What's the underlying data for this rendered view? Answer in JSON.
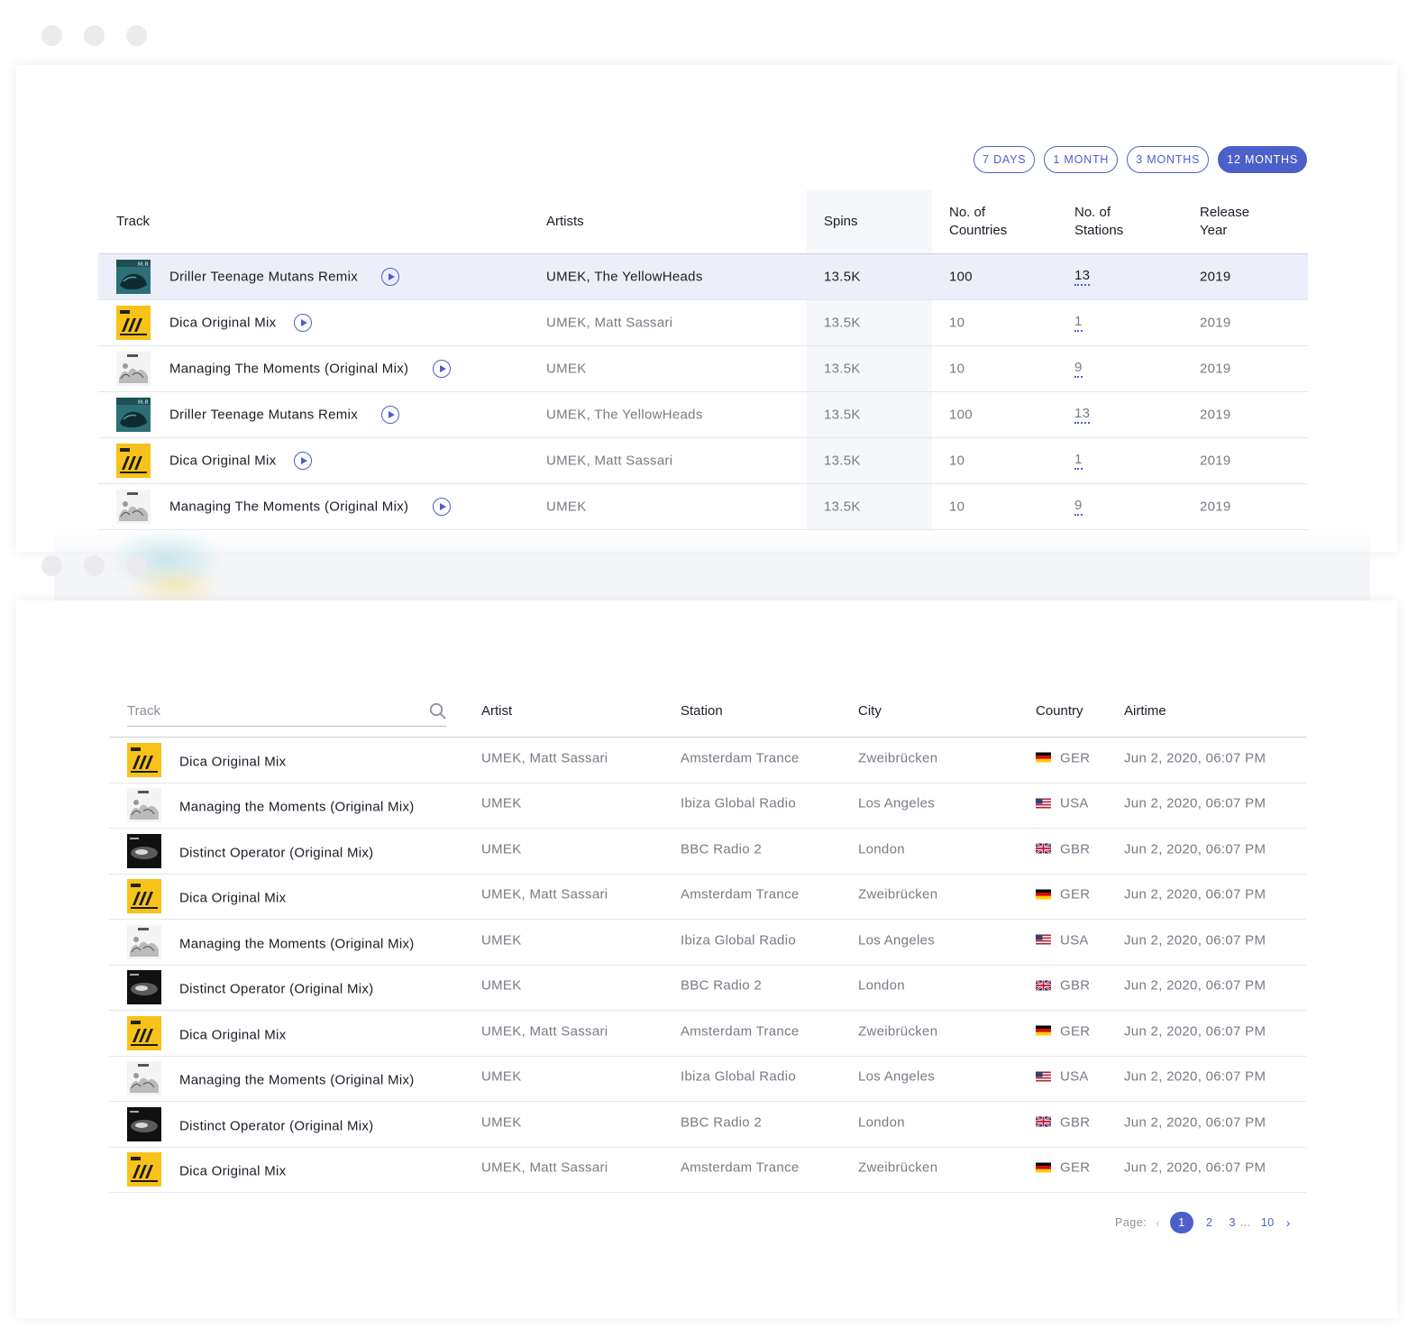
{
  "periods": [
    {
      "label": "7 DAYS",
      "active": false
    },
    {
      "label": "1 MONTH",
      "active": false
    },
    {
      "label": "3 MONTHS",
      "active": false
    },
    {
      "label": "12 MONTHS",
      "active": true
    }
  ],
  "tracks_table": {
    "headers": {
      "track": "Track",
      "artists": "Artists",
      "spins": "Spins",
      "countries_1": "No. of",
      "countries_2": "Countries",
      "stations_1": "No. of",
      "stations_2": "Stations",
      "release_1": "Release",
      "release_2": "Year"
    },
    "rows": [
      {
        "cover": "teal",
        "track": "Driller Teenage Mutans Remix",
        "artists": "UMEK, The YellowHeads",
        "spins": "13.5K",
        "countries": "100",
        "stations": "13",
        "year": "2019"
      },
      {
        "cover": "yellow",
        "track": "Dica Original Mix",
        "artists": "UMEK, Matt Sassari",
        "spins": "13.5K",
        "countries": "10",
        "stations": "1",
        "year": "2019"
      },
      {
        "cover": "sketch",
        "track": "Managing The Moments (Original Mix)",
        "artists": "UMEK",
        "spins": "13.5K",
        "countries": "10",
        "stations": "9",
        "year": "2019"
      },
      {
        "cover": "teal",
        "track": "Driller Teenage Mutans Remix",
        "artists": "UMEK, The YellowHeads",
        "spins": "13.5K",
        "countries": "100",
        "stations": "13",
        "year": "2019"
      },
      {
        "cover": "yellow",
        "track": "Dica Original Mix",
        "artists": "UMEK, Matt Sassari",
        "spins": "13.5K",
        "countries": "10",
        "stations": "1",
        "year": "2019"
      },
      {
        "cover": "sketch",
        "track": "Managing The Moments (Original Mix)",
        "artists": "UMEK",
        "spins": "13.5K",
        "countries": "10",
        "stations": "9",
        "year": "2019"
      }
    ]
  },
  "airplay_table": {
    "search_placeholder": "Track",
    "headers": {
      "artist": "Artist",
      "station": "Station",
      "city": "City",
      "country": "Country",
      "airtime": "Airtime"
    },
    "rows": [
      {
        "cover": "yellow",
        "track": "Dica Original Mix",
        "artist": "UMEK, Matt Sassari",
        "station": "Amsterdam Trance",
        "city": "Zweibrücken",
        "flag": "de",
        "country": "GER",
        "airtime": "Jun 2, 2020, 06:07 PM"
      },
      {
        "cover": "sketch",
        "track": "Managing the Moments (Original Mix)",
        "artist": "UMEK",
        "station": "Ibiza Global Radio",
        "city": "Los Angeles",
        "flag": "us",
        "country": "USA",
        "airtime": "Jun 2, 2020, 06:07 PM"
      },
      {
        "cover": "dark",
        "track": "Distinct Operator (Original Mix)",
        "artist": "UMEK",
        "station": "BBC Radio 2",
        "city": "London",
        "flag": "gb",
        "country": "GBR",
        "airtime": "Jun 2, 2020, 06:07 PM"
      },
      {
        "cover": "yellow",
        "track": "Dica Original Mix",
        "artist": "UMEK, Matt Sassari",
        "station": "Amsterdam Trance",
        "city": "Zweibrücken",
        "flag": "de",
        "country": "GER",
        "airtime": "Jun 2, 2020, 06:07 PM"
      },
      {
        "cover": "sketch",
        "track": "Managing the Moments (Original Mix)",
        "artist": "UMEK",
        "station": "Ibiza Global Radio",
        "city": "Los Angeles",
        "flag": "us",
        "country": "USA",
        "airtime": "Jun 2, 2020, 06:07 PM"
      },
      {
        "cover": "dark",
        "track": "Distinct Operator (Original Mix)",
        "artist": "UMEK",
        "station": "BBC Radio 2",
        "city": "London",
        "flag": "gb",
        "country": "GBR",
        "airtime": "Jun 2, 2020, 06:07 PM"
      },
      {
        "cover": "yellow",
        "track": "Dica Original Mix",
        "artist": "UMEK, Matt Sassari",
        "station": "Amsterdam Trance",
        "city": "Zweibrücken",
        "flag": "de",
        "country": "GER",
        "airtime": "Jun 2, 2020, 06:07 PM"
      },
      {
        "cover": "sketch",
        "track": "Managing the Moments (Original Mix)",
        "artist": "UMEK",
        "station": "Ibiza Global Radio",
        "city": "Los Angeles",
        "flag": "us",
        "country": "USA",
        "airtime": "Jun 2, 2020, 06:07 PM"
      },
      {
        "cover": "dark",
        "track": "Distinct Operator (Original Mix)",
        "artist": "UMEK",
        "station": "BBC Radio 2",
        "city": "London",
        "flag": "gb",
        "country": "GBR",
        "airtime": "Jun 2, 2020, 06:07 PM"
      },
      {
        "cover": "yellow",
        "track": "Dica Original Mix",
        "artist": "UMEK, Matt Sassari",
        "station": "Amsterdam Trance",
        "city": "Zweibrücken",
        "flag": "de",
        "country": "GER",
        "airtime": "Jun 2, 2020, 06:07 PM"
      }
    ]
  },
  "pagination": {
    "label": "Page:",
    "prev_icon": "chevron-left-icon",
    "pages": [
      "1",
      "2",
      "3"
    ],
    "ellipsis": "...",
    "last": "10",
    "current": "1",
    "next_icon": "chevron-right-icon"
  },
  "colors": {
    "accent": "#4d5fcb",
    "highlight_row": "#eceffa",
    "spins_column": "#f6f7fb",
    "muted_text": "#797b85"
  }
}
